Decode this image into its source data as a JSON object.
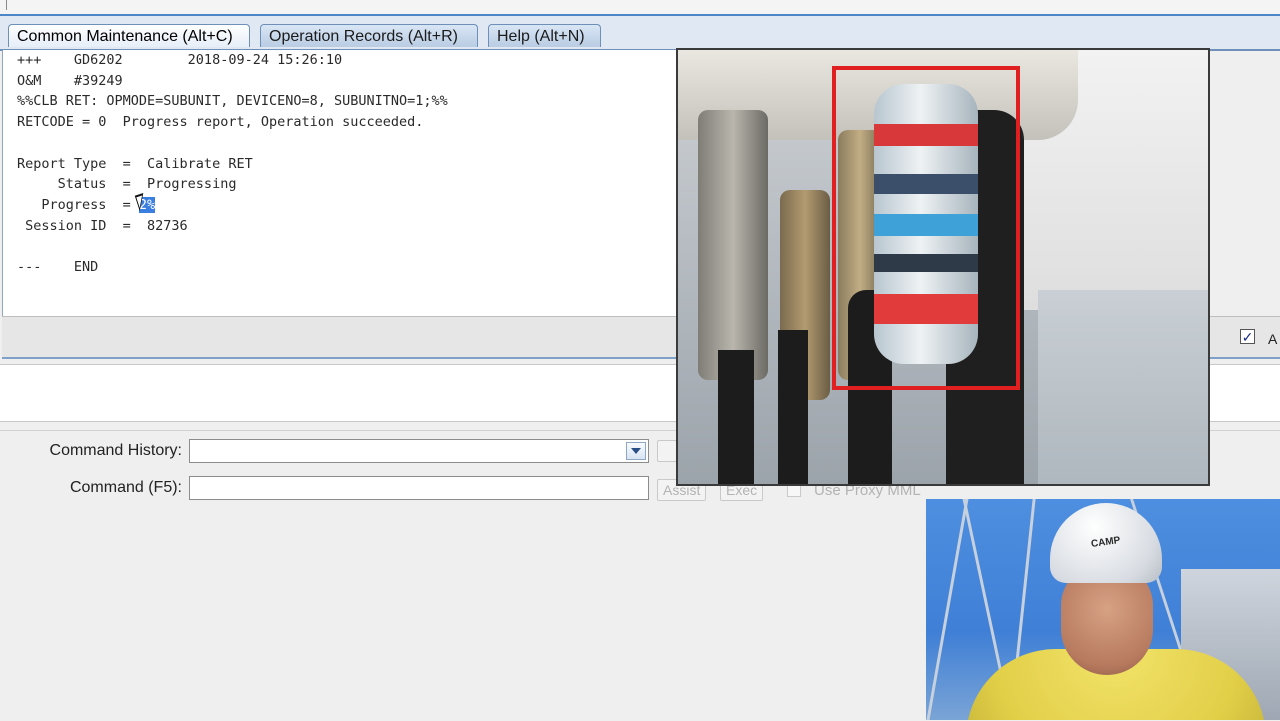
{
  "tabs": [
    {
      "label": "Common Maintenance (Alt+C)",
      "active": true
    },
    {
      "label": "Operation Records (Alt+R)",
      "active": false
    },
    {
      "label": "Help (Alt+N)",
      "active": false
    }
  ],
  "console": {
    "lines": [
      "+++    GD6202        2018-09-24 15:26:10",
      "O&M    #39249",
      "%%CLB RET: OPMODE=SUBUNIT, DEVICENO=8, SUBUNITNO=1;%%",
      "RETCODE = 0  Progress report, Operation succeeded.",
      "",
      "Report Type  =  Calibrate RET",
      "     Status  =  Progressing",
      "   Progress  = ",
      " Session ID  =  82736",
      "",
      "---    END"
    ],
    "progress_value": "2%"
  },
  "command": {
    "history_label": "Command History:",
    "history_value": "",
    "command_label": "Command (F5):",
    "command_value": "",
    "assist_label": "Assist",
    "exec_label": "Exec",
    "proxy_label": "Use Proxy MML",
    "auto_label": "A"
  },
  "overlays": {
    "camera_feed": "camera-feed",
    "webcam_helmet_text": "CAMP"
  },
  "colors": {
    "selection": "#3a7fe0",
    "highlight_box": "#e02020",
    "tab_border": "#6d8fb8"
  }
}
